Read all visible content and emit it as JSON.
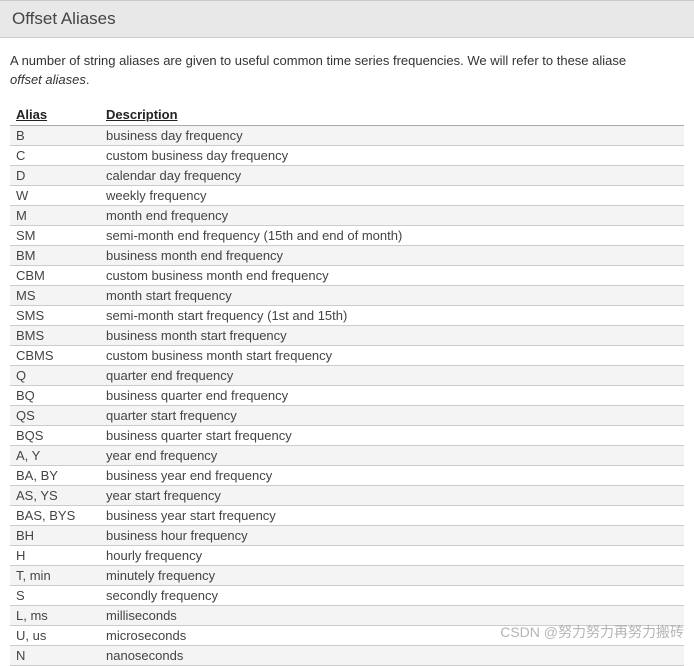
{
  "header": {
    "title": "Offset Aliases"
  },
  "intro": {
    "text_part1": "A number of string aliases are given to useful common time series frequencies. We will refer to these aliase",
    "text_part2_italic": "offset aliases",
    "text_part3": "."
  },
  "table": {
    "headers": {
      "alias": "Alias",
      "description": "Description"
    },
    "rows": [
      {
        "alias": "B",
        "description": "business day frequency"
      },
      {
        "alias": "C",
        "description": "custom business day frequency"
      },
      {
        "alias": "D",
        "description": "calendar day frequency"
      },
      {
        "alias": "W",
        "description": "weekly frequency"
      },
      {
        "alias": "M",
        "description": "month end frequency"
      },
      {
        "alias": "SM",
        "description": "semi-month end frequency (15th and end of month)"
      },
      {
        "alias": "BM",
        "description": "business month end frequency"
      },
      {
        "alias": "CBM",
        "description": "custom business month end frequency"
      },
      {
        "alias": "MS",
        "description": "month start frequency"
      },
      {
        "alias": "SMS",
        "description": "semi-month start frequency (1st and 15th)"
      },
      {
        "alias": "BMS",
        "description": "business month start frequency"
      },
      {
        "alias": "CBMS",
        "description": "custom business month start frequency"
      },
      {
        "alias": "Q",
        "description": "quarter end frequency"
      },
      {
        "alias": "BQ",
        "description": "business quarter end frequency"
      },
      {
        "alias": "QS",
        "description": "quarter start frequency"
      },
      {
        "alias": "BQS",
        "description": "business quarter start frequency"
      },
      {
        "alias": "A, Y",
        "description": "year end frequency"
      },
      {
        "alias": "BA, BY",
        "description": "business year end frequency"
      },
      {
        "alias": "AS, YS",
        "description": "year start frequency"
      },
      {
        "alias": "BAS, BYS",
        "description": "business year start frequency"
      },
      {
        "alias": "BH",
        "description": "business hour frequency"
      },
      {
        "alias": "H",
        "description": "hourly frequency"
      },
      {
        "alias": "T, min",
        "description": "minutely frequency"
      },
      {
        "alias": "S",
        "description": "secondly frequency"
      },
      {
        "alias": "L, ms",
        "description": "milliseconds"
      },
      {
        "alias": "U, us",
        "description": "microseconds"
      },
      {
        "alias": "N",
        "description": "nanoseconds"
      }
    ]
  },
  "watermark": {
    "text": "CSDN @努力努力再努力搬砖"
  }
}
